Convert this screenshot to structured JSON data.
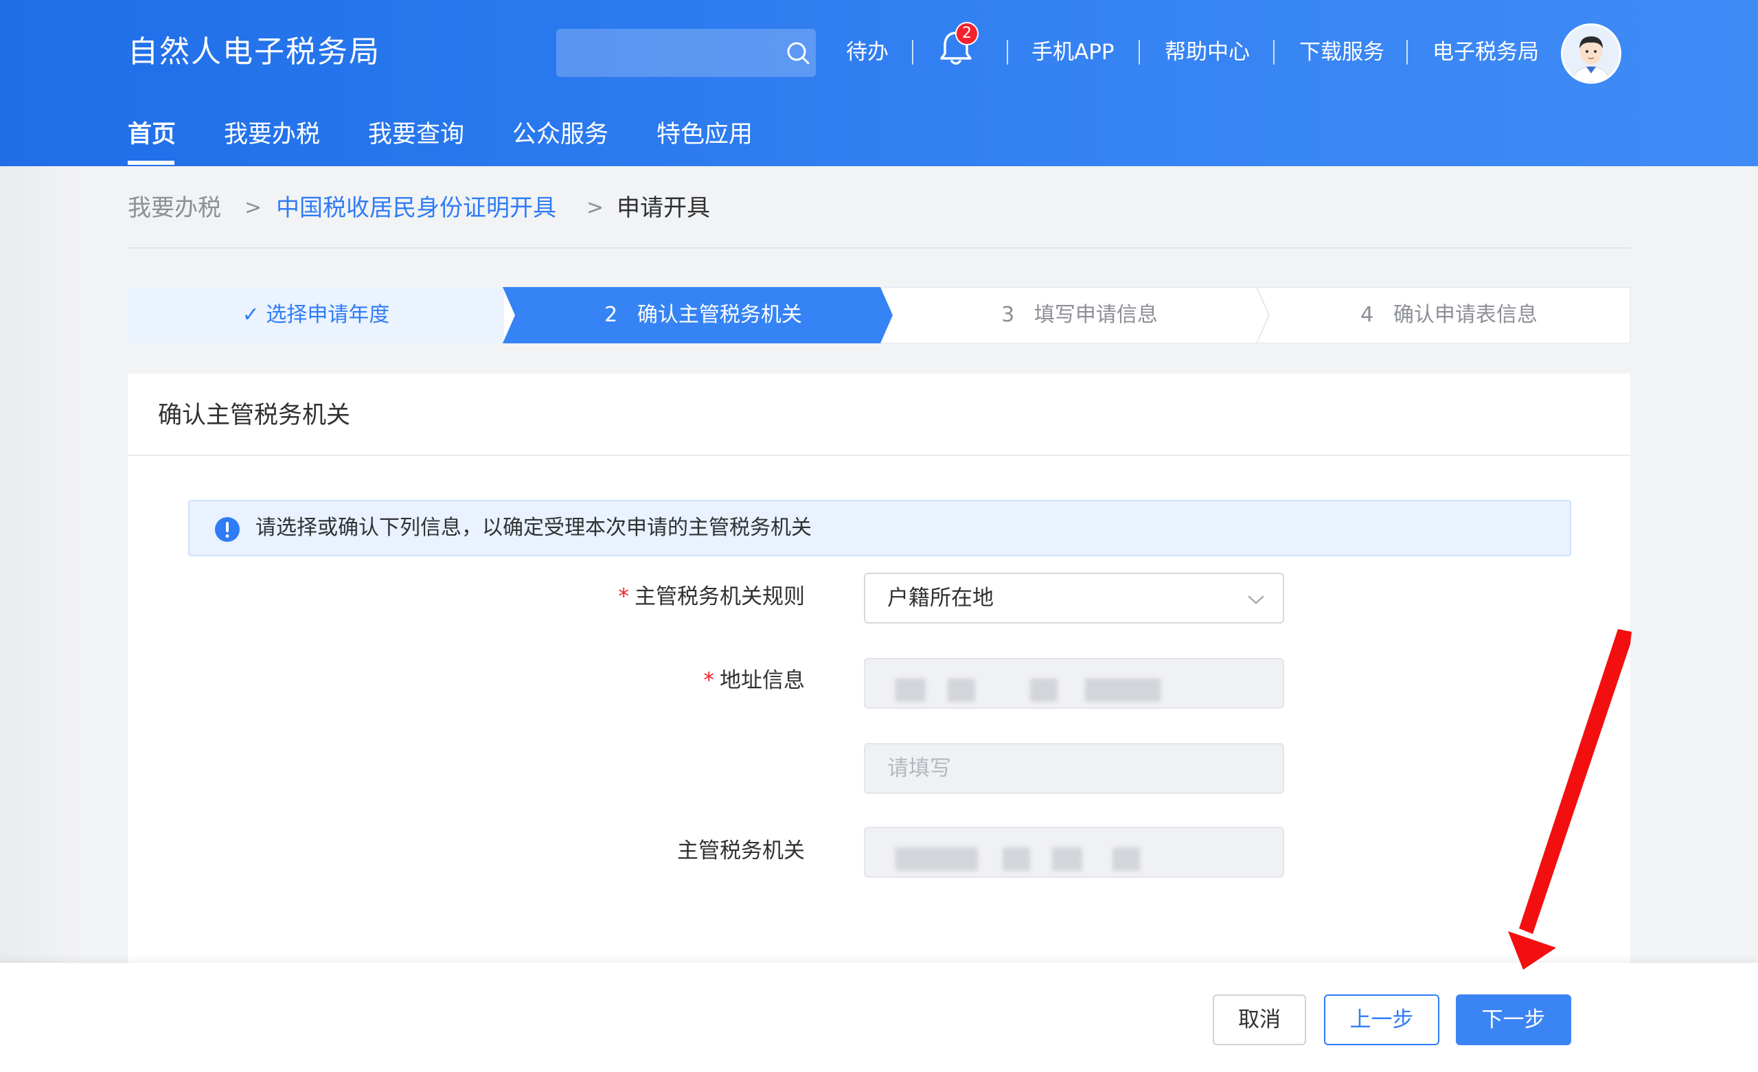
{
  "header": {
    "brand": "自然人电子税务局",
    "search": {
      "placeholder": ""
    },
    "links": {
      "todo": "待办",
      "mobile_app": "手机APP",
      "help_center": "帮助中心",
      "download": "下载服务",
      "e_tax_bureau": "电子税务局"
    },
    "notification_count": "2"
  },
  "nav": {
    "items": [
      {
        "label": "首页",
        "active": true
      },
      {
        "label": "我要办税",
        "active": false
      },
      {
        "label": "我要查询",
        "active": false
      },
      {
        "label": "公众服务",
        "active": false
      },
      {
        "label": "特色应用",
        "active": false
      }
    ]
  },
  "breadcrumb": {
    "items": [
      "我要办税",
      "中国税收居民身份证明开具",
      "申请开具"
    ],
    "separator": ">"
  },
  "steps": [
    {
      "label": "选择申请年度",
      "status": "done",
      "check": "✓"
    },
    {
      "number": "2",
      "label": "确认主管税务机关",
      "status": "active"
    },
    {
      "number": "3",
      "label": "填写申请信息",
      "status": "pending"
    },
    {
      "number": "4",
      "label": "确认申请表信息",
      "status": "pending"
    }
  ],
  "card": {
    "title": "确认主管税务机关",
    "alert": "请选择或确认下列信息，以确定受理本次申请的主管税务机关",
    "form": {
      "rule_label": "主管税务机关规则",
      "rule_value": "户籍所在地",
      "address_label": "地址信息",
      "address_detail_placeholder": "请填写",
      "tax_office_label": "主管税务机关",
      "required_mark": "*"
    }
  },
  "actions": {
    "cancel": "取消",
    "prev": "上一步",
    "next": "下一步"
  },
  "colors": {
    "primary": "#2f7cf6",
    "header_gradient_start": "#1f6ee8",
    "header_gradient_end": "#3f8bf6",
    "required": "#f5222d",
    "annotation_arrow": "#f30f0f"
  }
}
